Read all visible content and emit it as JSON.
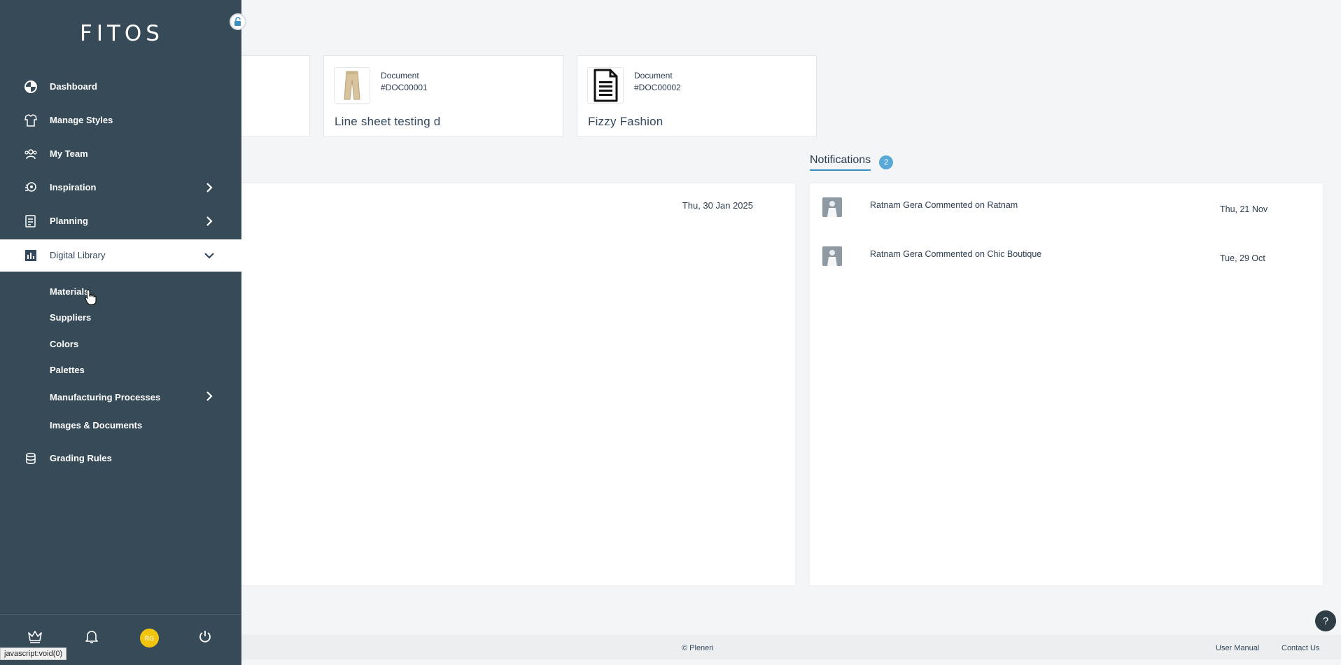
{
  "sidebar": {
    "logo": "FITOS",
    "nav": [
      {
        "label": "Dashboard",
        "icon": "dashboard-icon"
      },
      {
        "label": "Manage Styles",
        "icon": "hanger-icon"
      },
      {
        "label": "My Team",
        "icon": "team-icon"
      },
      {
        "label": "Inspiration",
        "icon": "inspiration-icon",
        "expandable": true
      },
      {
        "label": "Planning",
        "icon": "planning-icon",
        "expandable": true
      },
      {
        "label": "Digital Library",
        "icon": "chart-icon",
        "expanded": true
      },
      {
        "label": "Grading Rules",
        "icon": "grading-icon"
      }
    ],
    "sub_items": [
      {
        "label": "Materials"
      },
      {
        "label": "Suppliers"
      },
      {
        "label": "Colors"
      },
      {
        "label": "Palettes"
      },
      {
        "label": "Manufacturing Processes",
        "expandable": true
      },
      {
        "label": "Images & Documents"
      }
    ],
    "user_initials": "RG"
  },
  "documents": [
    {
      "type": "Document",
      "id": "#DOC00001",
      "name": "Line sheet testing d",
      "thumb": "pants-thumbnail"
    },
    {
      "type": "Document",
      "id": "#DOC00002",
      "name": "Fizzy Fashion",
      "thumb": "document-icon"
    }
  ],
  "activity": {
    "date": "Thu, 30 Jan 2025"
  },
  "notifications": {
    "title": "Notifications",
    "count": "2",
    "items": [
      {
        "text": "Ratnam Gera Commented on Ratnam",
        "date": "Thu, 21 Nov"
      },
      {
        "text": "Ratnam Gera Commented on Chic Boutique",
        "date": "Tue, 29 Oct"
      }
    ]
  },
  "footer": {
    "copyright": "© Pleneri",
    "user_manual": "User Manual",
    "contact_us": "Contact Us"
  },
  "help_label": "?",
  "status_bar": "javascript:void(0)",
  "colors": {
    "sidebar_bg": "#364a57",
    "accent": "#3a8fc0",
    "badge": "#59a9d6",
    "avatar": "#f1c40f"
  }
}
